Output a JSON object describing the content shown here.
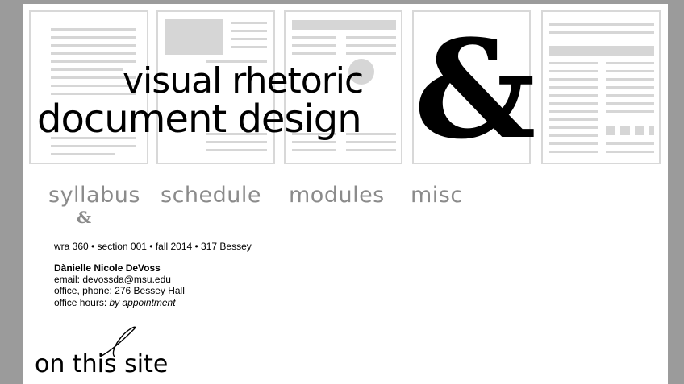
{
  "header": {
    "title_line1": "visual rhetoric",
    "title_line2": "document design",
    "ampersand": "&"
  },
  "nav": {
    "items": [
      {
        "label": "syllabus"
      },
      {
        "label": "schedule"
      },
      {
        "label": "modules"
      },
      {
        "label": "misc"
      }
    ],
    "active_marker": "&"
  },
  "course": {
    "info": "wra 360 • section 001 • fall 2014 • 317 Bessey"
  },
  "instructor": {
    "name": "Dànielle Nicole DeVoss",
    "email": "email: devossda@msu.edu",
    "office": "office, phone: 276 Bessey Hall",
    "hours_label": "office hours: ",
    "hours_value": "by appointment"
  },
  "section": {
    "heading": "on this site"
  },
  "colors": {
    "page_bg": "#ffffff",
    "frame_bg": "#9b9b9b",
    "nav_text": "#8b8b8b",
    "sheet_line": "#d6d6d6"
  }
}
